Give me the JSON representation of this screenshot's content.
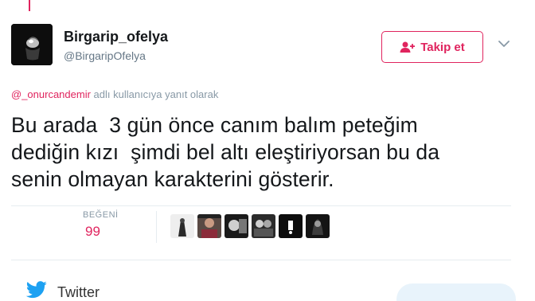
{
  "tweet": {
    "display_name": "Birgarip_ofelya",
    "handle": "@BirgaripOfelya",
    "follow_label": "Takip et",
    "reply_context": {
      "mention": "@_onurcandemir",
      "suffix": " adlı kullanıcıya yanıt olarak"
    },
    "text": "Bu arada  3 gün önce canım balım peteğim\ndediğin kızı  şimdi bel altı eleştiriyorsan bu da\nsenin olmayan karakterini gösterir.",
    "likes_label": "BEĞENİ",
    "likes_count": "99",
    "liker_count_shown": 6
  },
  "footer": {
    "brand": "Twitter"
  },
  "colors": {
    "accent": "#e0245e",
    "muted": "#8899a6",
    "text": "#14171a",
    "twitter_blue": "#1da1f2"
  },
  "icons": {
    "follow": "add-user-icon",
    "more": "chevron-down-icon",
    "brand": "twitter-bird-icon"
  }
}
